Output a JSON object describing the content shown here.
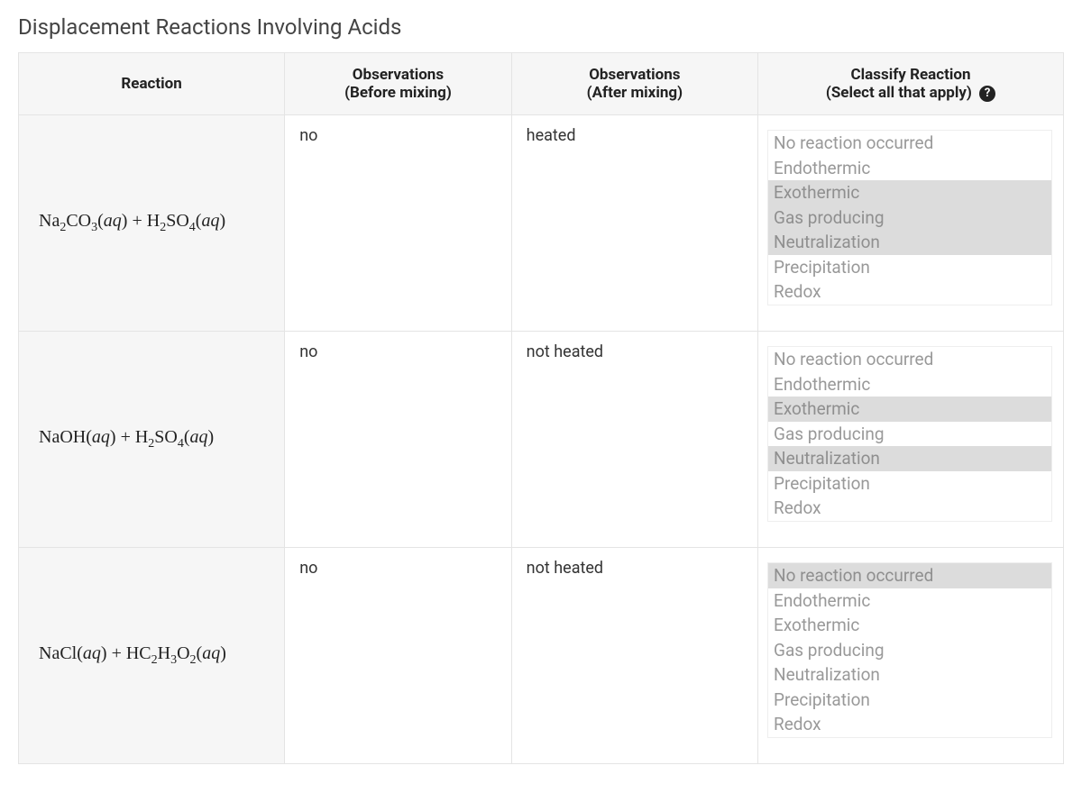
{
  "title": "Displacement Reactions Involving Acids",
  "headers": {
    "reaction": "Reaction",
    "before_line1": "Observations",
    "before_line2": "(Before mixing)",
    "after_line1": "Observations",
    "after_line2": "(After mixing)",
    "classify_line1": "Classify Reaction",
    "classify_line2": "(Select all that apply)",
    "help_symbol": "?"
  },
  "classify_options": [
    "No reaction occurred",
    "Endothermic",
    "Exothermic",
    "Gas producing",
    "Neutralization",
    "Precipitation",
    "Redox"
  ],
  "rows": [
    {
      "reaction_html": "Na<sub>2</sub>CO<sub>3</sub><span class='paren'>(<span class='aq'>aq</span>)</span> + H<sub>2</sub>SO<sub>4</sub><span class='paren'>(<span class='aq'>aq</span>)</span>",
      "before": "no",
      "after": "heated",
      "selected": [
        "Exothermic",
        "Gas producing",
        "Neutralization"
      ]
    },
    {
      "reaction_html": "NaOH<span class='paren'>(<span class='aq'>aq</span>)</span> + H<sub>2</sub>SO<sub>4</sub><span class='paren'>(<span class='aq'>aq</span>)</span>",
      "before": "no",
      "after": "not heated",
      "selected": [
        "Exothermic",
        "Neutralization"
      ]
    },
    {
      "reaction_html": "NaCl<span class='paren'>(<span class='aq'>aq</span>)</span> + HC<sub>2</sub>H<sub>3</sub>O<sub>2</sub><span class='paren'>(<span class='aq'>aq</span>)</span>",
      "before": "no",
      "after": "not heated",
      "selected": [
        "No reaction occurred"
      ]
    }
  ]
}
